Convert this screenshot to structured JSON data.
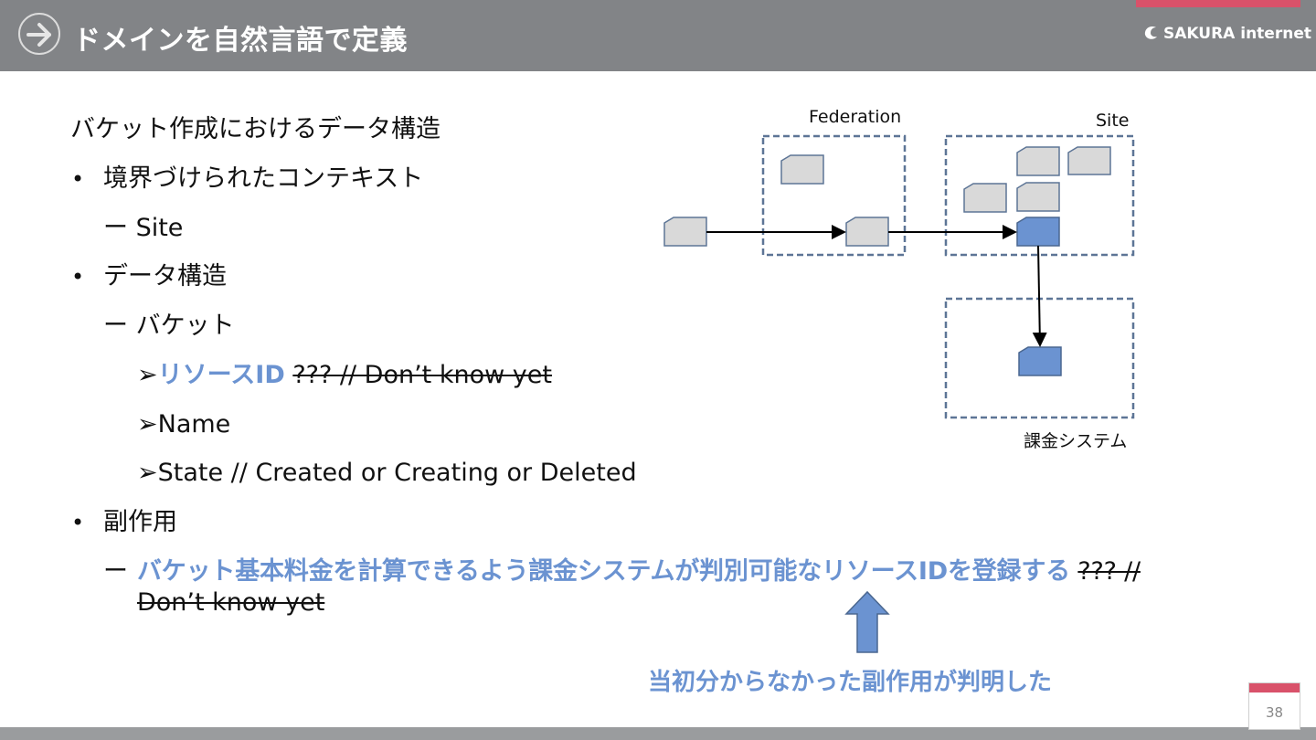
{
  "header": {
    "title": "ドメインを自然言語で定義",
    "logo": "SAKURA internet",
    "colors": {
      "bar": "#828487",
      "accent": "#d9526a"
    }
  },
  "content": {
    "heading": "バケット作成におけるデータ構造",
    "bullet1": "境界づけられたコンテキスト",
    "dash1": "ー Site",
    "bullet2": "データ構造",
    "dash2": "ー バケット",
    "arrow_marker": "➢",
    "sub1_blue": "リソースID",
    "sub1_strike": "??? // Don’t know yet",
    "sub2": "Name",
    "sub3": "State // Created or Creating or Deleted",
    "bullet3": "副作用",
    "dash3_prefix": "ー",
    "dash3_blue": "バケット基本料金を計算できるよう課金システムが判別可能なリソースIDを登録する",
    "dash3_strike_a": "??? //",
    "dash3_strike_b": "Don’t know yet",
    "accent_color": "#6b93d1"
  },
  "diagram": {
    "federation_label": "Federation",
    "site_label": "Site",
    "billing_label": "課金システム"
  },
  "callout": {
    "text": "当初分からなかった副作用が判明した"
  },
  "page_number": "38"
}
